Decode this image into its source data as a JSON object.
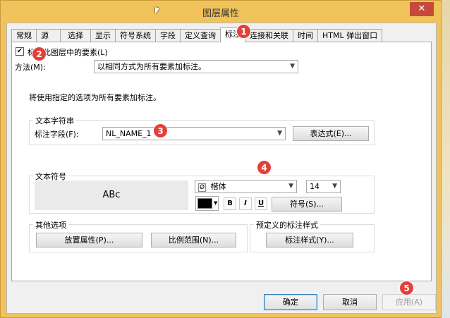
{
  "window": {
    "title": "图层属性",
    "close_label": "✕"
  },
  "tabs": [
    "常规",
    "源",
    "选择",
    "显示",
    "符号系统",
    "字段",
    "定义查询",
    "标注",
    "连接和关联",
    "时间",
    "HTML 弹出窗口"
  ],
  "label_checkbox": {
    "label": "标注此图层中的要素(L)",
    "checked": "✔"
  },
  "method": {
    "label": "方法(M):",
    "value": "以相同方式为所有要素加标注。"
  },
  "info_text": "将使用指定的选项为所有要素加标注。",
  "text_string": {
    "legend": "文本字符串",
    "field_label": "标注字段(F):",
    "field_value": "NL_NAME_1",
    "expression_button": "表达式(E)..."
  },
  "text_symbol": {
    "legend": "文本符号",
    "sample": "ABc",
    "font": "楷体",
    "font_icon": "Ø",
    "size": "14",
    "bold": "B",
    "italic": "I",
    "underline": "U",
    "symbol_button": "符号(S)...",
    "color": "#000000"
  },
  "other_options": {
    "legend": "其他选项",
    "placement_button": "放置属性(P)...",
    "scale_button": "比例范围(N)..."
  },
  "predefined": {
    "legend": "预定义的标注样式",
    "style_button": "标注样式(Y)..."
  },
  "buttons": {
    "ok": "确定",
    "cancel": "取消",
    "apply": "应用(A)"
  },
  "badges": [
    "1",
    "2",
    "3",
    "4",
    "5"
  ]
}
